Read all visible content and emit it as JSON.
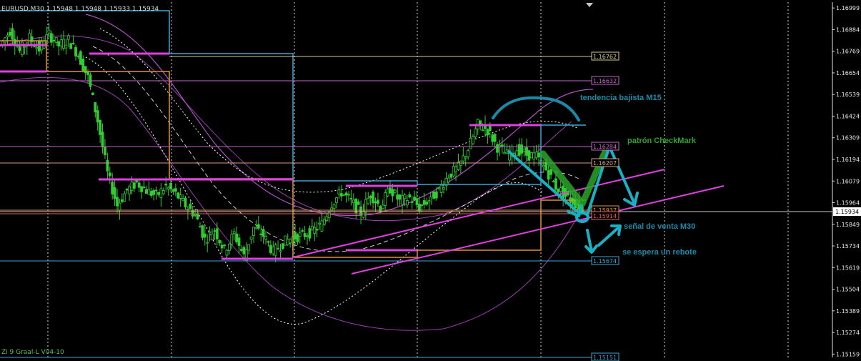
{
  "title": "EURUSD,M30  1.15948 1.15948 1.15933 1.15934",
  "indicator_label": "Zi 9 Graal-L V04-10",
  "colors": {
    "background": "#000000",
    "candle": "#33cc33",
    "blue_level": "#3aa6d6",
    "orange_level": "#e0903a",
    "magenta": "#e040e0",
    "violet": "#b24fc0",
    "annotation_teal": "#1a9fb0",
    "annotation_green": "#2aa52a"
  },
  "annotations": [
    {
      "id": "m15",
      "text": "tendencia bajista M15",
      "color": "#1a8aa8"
    },
    {
      "id": "checkmark",
      "text": "patrón CheckMark",
      "color": "#2aa52a"
    },
    {
      "id": "sell",
      "text": "señal de venta M30",
      "color": "#1a8aa8"
    },
    {
      "id": "rebound",
      "text": "se espera un rebote",
      "color": "#1a8aa8"
    }
  ],
  "chart_data": {
    "type": "line",
    "symbol": "EURUSD",
    "timeframe": "M30",
    "ohlc_header": {
      "open": 1.15948,
      "high": 1.15948,
      "low": 1.15933,
      "close": 1.15934
    },
    "ylim": [
      1.1513,
      1.1703
    ],
    "y_ticks": [
      1.16999,
      1.16884,
      1.16769,
      1.16654,
      1.16539,
      1.16424,
      1.16309,
      1.16194,
      1.16079,
      1.15964,
      1.15849,
      1.15734,
      1.15619,
      1.15504,
      1.15389,
      1.15274,
      1.15159
    ],
    "current_price": 1.15934,
    "level_labels": [
      {
        "value": 1.16762,
        "text": "1.16762",
        "color": "#d4c890"
      },
      {
        "value": 1.16632,
        "text": "1.16632",
        "color": "#c266c8"
      },
      {
        "value": 1.16284,
        "text": "1.16284",
        "color": "#c266c8"
      },
      {
        "value": 1.16207,
        "text": "1.16207",
        "color": "#d4a080"
      },
      {
        "value": 1.15937,
        "text": "1.15937",
        "color": "#e0903a"
      },
      {
        "value": 1.15914,
        "text": "1.15914",
        "color": "#e06060"
      },
      {
        "value": 1.15674,
        "text": "1.15674",
        "color": "#3aa6d6"
      },
      {
        "value": 1.15151,
        "text": "1.15151",
        "color": "#3aa6d6"
      }
    ],
    "price_series": [
      {
        "x": 0,
        "y": 1.168
      },
      {
        "x": 3,
        "y": 1.1688
      },
      {
        "x": 6,
        "y": 1.1677
      },
      {
        "x": 9,
        "y": 1.1684
      },
      {
        "x": 12,
        "y": 1.1678
      },
      {
        "x": 15,
        "y": 1.1686
      },
      {
        "x": 18,
        "y": 1.168
      },
      {
        "x": 21,
        "y": 1.1683
      },
      {
        "x": 24,
        "y": 1.1675
      },
      {
        "x": 27,
        "y": 1.1663
      },
      {
        "x": 30,
        "y": 1.164
      },
      {
        "x": 33,
        "y": 1.1612
      },
      {
        "x": 36,
        "y": 1.1595
      },
      {
        "x": 39,
        "y": 1.1603
      },
      {
        "x": 42,
        "y": 1.1607
      },
      {
        "x": 45,
        "y": 1.1603
      },
      {
        "x": 48,
        "y": 1.16
      },
      {
        "x": 51,
        "y": 1.1605
      },
      {
        "x": 54,
        "y": 1.1601
      },
      {
        "x": 57,
        "y": 1.1595
      },
      {
        "x": 60,
        "y": 1.159
      },
      {
        "x": 63,
        "y": 1.1577
      },
      {
        "x": 66,
        "y": 1.1582
      },
      {
        "x": 69,
        "y": 1.1571
      },
      {
        "x": 72,
        "y": 1.158
      },
      {
        "x": 75,
        "y": 1.1568
      },
      {
        "x": 78,
        "y": 1.1583
      },
      {
        "x": 81,
        "y": 1.1579
      },
      {
        "x": 84,
        "y": 1.157
      },
      {
        "x": 87,
        "y": 1.1575
      },
      {
        "x": 90,
        "y": 1.1578
      },
      {
        "x": 93,
        "y": 1.1579
      },
      {
        "x": 96,
        "y": 1.1581
      },
      {
        "x": 99,
        "y": 1.1585
      },
      {
        "x": 102,
        "y": 1.1596
      },
      {
        "x": 105,
        "y": 1.1602
      },
      {
        "x": 108,
        "y": 1.1597
      },
      {
        "x": 111,
        "y": 1.1591
      },
      {
        "x": 114,
        "y": 1.1601
      },
      {
        "x": 117,
        "y": 1.1594
      },
      {
        "x": 120,
        "y": 1.1604
      },
      {
        "x": 123,
        "y": 1.1597
      },
      {
        "x": 126,
        "y": 1.1599
      },
      {
        "x": 129,
        "y": 1.1594
      },
      {
        "x": 132,
        "y": 1.1598
      },
      {
        "x": 135,
        "y": 1.1603
      },
      {
        "x": 138,
        "y": 1.1611
      },
      {
        "x": 141,
        "y": 1.1615
      },
      {
        "x": 144,
        "y": 1.1625
      },
      {
        "x": 147,
        "y": 1.1638
      },
      {
        "x": 150,
        "y": 1.1635
      },
      {
        "x": 153,
        "y": 1.1626
      },
      {
        "x": 156,
        "y": 1.1622
      },
      {
        "x": 159,
        "y": 1.1625
      },
      {
        "x": 162,
        "y": 1.1622
      },
      {
        "x": 165,
        "y": 1.1621
      },
      {
        "x": 168,
        "y": 1.1614
      },
      {
        "x": 171,
        "y": 1.1605
      },
      {
        "x": 174,
        "y": 1.16
      },
      {
        "x": 177,
        "y": 1.1596
      },
      {
        "x": 179,
        "y": 1.15934
      }
    ]
  }
}
